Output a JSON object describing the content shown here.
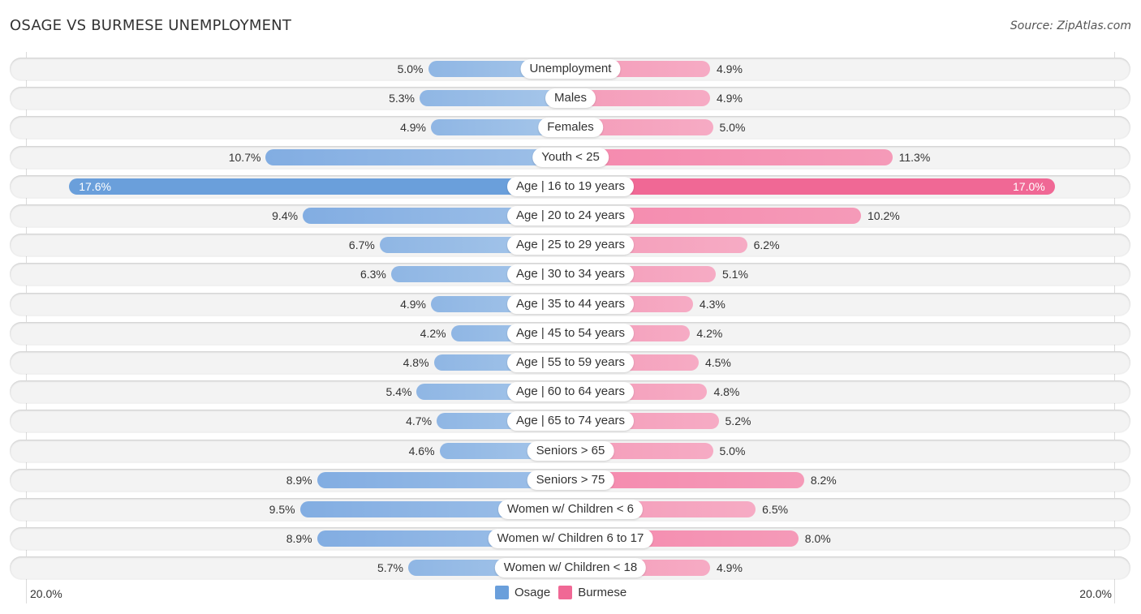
{
  "header": {
    "title": "OSAGE VS BURMESE UNEMPLOYMENT",
    "source": "Source: ZipAtlas.com"
  },
  "colors": {
    "osage": "#6a9fdb",
    "burmese": "#f06895"
  },
  "chart_data": {
    "type": "bar",
    "orientation": "horizontal-diverging",
    "title": "OSAGE VS BURMESE UNEMPLOYMENT",
    "xlabel": "",
    "ylabel": "",
    "xlim": [
      -20.0,
      20.0
    ],
    "axis_tick_labels": {
      "left": "20.0%",
      "right": "20.0%"
    },
    "legend": {
      "placement": "bottom-center",
      "entries": [
        "Osage",
        "Burmese"
      ]
    },
    "categories": [
      "Unemployment",
      "Males",
      "Females",
      "Youth < 25",
      "Age | 16 to 19 years",
      "Age | 20 to 24 years",
      "Age | 25 to 29 years",
      "Age | 30 to 34 years",
      "Age | 35 to 44 years",
      "Age | 45 to 54 years",
      "Age | 55 to 59 years",
      "Age | 60 to 64 years",
      "Age | 65 to 74 years",
      "Seniors > 65",
      "Seniors > 75",
      "Women w/ Children < 6",
      "Women w/ Children 6 to 17",
      "Women w/ Children < 18"
    ],
    "series": [
      {
        "name": "Osage",
        "side": "left",
        "values": [
          5.0,
          5.3,
          4.9,
          10.7,
          17.6,
          9.4,
          6.7,
          6.3,
          4.9,
          4.2,
          4.8,
          5.4,
          4.7,
          4.6,
          8.9,
          9.5,
          8.9,
          5.7
        ],
        "labels": [
          "5.0%",
          "5.3%",
          "4.9%",
          "10.7%",
          "17.6%",
          "9.4%",
          "6.7%",
          "6.3%",
          "4.9%",
          "4.2%",
          "4.8%",
          "5.4%",
          "4.7%",
          "4.6%",
          "8.9%",
          "9.5%",
          "8.9%",
          "5.7%"
        ]
      },
      {
        "name": "Burmese",
        "side": "right",
        "values": [
          4.9,
          4.9,
          5.0,
          11.3,
          17.0,
          10.2,
          6.2,
          5.1,
          4.3,
          4.2,
          4.5,
          4.8,
          5.2,
          5.0,
          8.2,
          6.5,
          8.0,
          4.9
        ],
        "labels": [
          "4.9%",
          "4.9%",
          "5.0%",
          "11.3%",
          "17.0%",
          "10.2%",
          "6.2%",
          "5.1%",
          "4.3%",
          "4.2%",
          "4.5%",
          "4.8%",
          "5.2%",
          "5.0%",
          "8.2%",
          "6.5%",
          "8.0%",
          "4.9%"
        ]
      }
    ],
    "grid": false
  }
}
